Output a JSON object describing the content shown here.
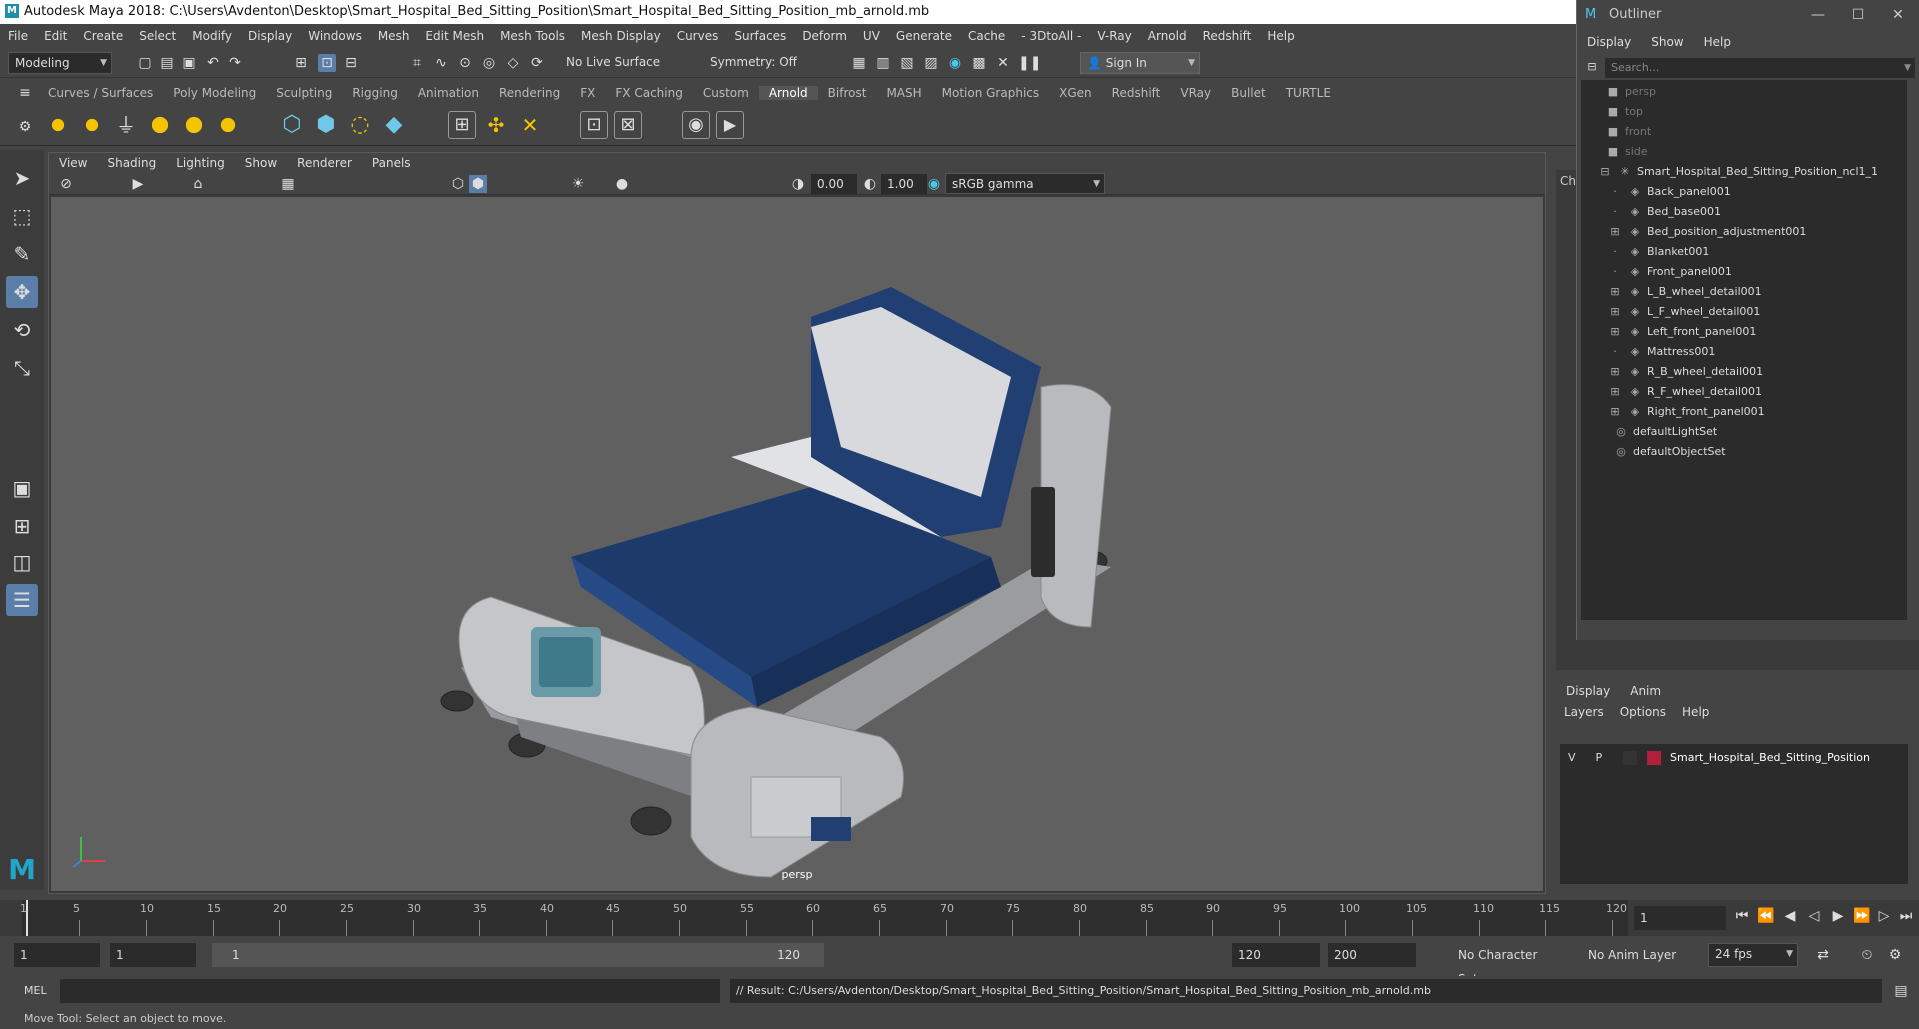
{
  "window": {
    "title": "Autodesk Maya 2018: C:\\Users\\Avdenton\\Desktop\\Smart_Hospital_Bed_Sitting_Position\\Smart_Hospital_Bed_Sitting_Position_mb_arnold.mb"
  },
  "menubar": [
    "File",
    "Edit",
    "Create",
    "Select",
    "Modify",
    "Display",
    "Windows",
    "Mesh",
    "Edit Mesh",
    "Mesh Tools",
    "Mesh Display",
    "Curves",
    "Surfaces",
    "Deform",
    "UV",
    "Generate",
    "Cache",
    "- 3DtoAll -",
    "V-Ray",
    "Arnold",
    "Redshift",
    "Help"
  ],
  "status": {
    "mode": "Modeling",
    "live_surface": "No Live Surface",
    "symmetry": "Symmetry: Off",
    "sign_in": "Sign In"
  },
  "shelf_tabs": [
    "Curves / Surfaces",
    "Poly Modeling",
    "Sculpting",
    "Rigging",
    "Animation",
    "Rendering",
    "FX",
    "FX Caching",
    "Custom",
    "Arnold",
    "Bifrost",
    "MASH",
    "Motion Graphics",
    "XGen",
    "Redshift",
    "VRay",
    "Bullet",
    "TURTLE"
  ],
  "shelf_active": "Arnold",
  "panel_menu": [
    "View",
    "Shading",
    "Lighting",
    "Show",
    "Renderer",
    "Panels"
  ],
  "panel_bar": {
    "exposure": "0.00",
    "gamma": "1.00",
    "color_space": "sRGB gamma"
  },
  "viewport": {
    "camera_label": "persp"
  },
  "outliner": {
    "title": "Outliner",
    "menu": [
      "Display",
      "Show",
      "Help"
    ],
    "search_placeholder": "Search...",
    "cameras": [
      "persp",
      "top",
      "front",
      "side"
    ],
    "root": "Smart_Hospital_Bed_Sitting_Position_ncl1_1",
    "children": [
      "Back_panel001",
      "Bed_base001",
      "Bed_position_adjustment001",
      "Blanket001",
      "Front_panel001",
      "L_B_wheel_detail001",
      "L_F_wheel_detail001",
      "Left_front_panel001",
      "Mattress001",
      "R_B_wheel_detail001",
      "R_F_wheel_detail001",
      "Right_front_panel001"
    ],
    "sets": [
      "defaultLightSet",
      "defaultObjectSet"
    ]
  },
  "channel_box_tab": "Ch",
  "layer_editor": {
    "tabs": [
      "Display",
      "Anim"
    ],
    "menu": [
      "Layers",
      "Options",
      "Help"
    ],
    "layer": {
      "v": "V",
      "p": "P",
      "name": "Smart_Hospital_Bed_Sitting_Position",
      "color": "#b0203a"
    }
  },
  "timeline": {
    "ticks": [
      "1",
      "5",
      "10",
      "15",
      "20",
      "25",
      "30",
      "35",
      "40",
      "45",
      "50",
      "55",
      "60",
      "65",
      "70",
      "75",
      "80",
      "85",
      "90",
      "95",
      "100",
      "105",
      "110",
      "115",
      "120"
    ],
    "current_frame": "1"
  },
  "range": {
    "start": "1",
    "anim_start": "1",
    "slider_start": "1",
    "slider_end": "120",
    "end": "120",
    "anim_end": "200",
    "char_set": "No Character Set",
    "anim_layer": "No Anim Layer",
    "fps": "24 fps"
  },
  "command": {
    "lang": "MEL",
    "result": "// Result: C:/Users/Avdenton/Desktop/Smart_Hospital_Bed_Sitting_Position/Smart_Hospital_Bed_Sitting_Position_mb_arnold.mb"
  },
  "help_line": "Move Tool: Select an object to move."
}
